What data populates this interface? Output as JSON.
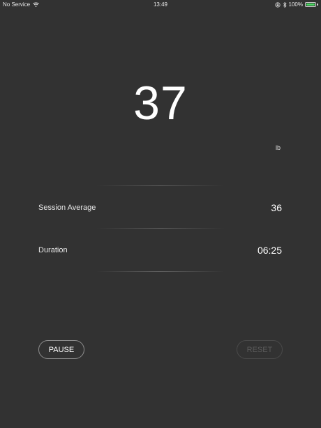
{
  "status_bar": {
    "carrier": "No Service",
    "time": "13:49",
    "battery_percent": "100%"
  },
  "reading": {
    "value": "37",
    "unit": "lb"
  },
  "stats": [
    {
      "label": "Session Average",
      "value": "36"
    },
    {
      "label": "Duration",
      "value": "06:25"
    }
  ],
  "buttons": {
    "pause_label": "PAUSE",
    "reset_label": "RESET"
  },
  "colors": {
    "background": "#323232",
    "battery_fill": "#4cd964"
  }
}
